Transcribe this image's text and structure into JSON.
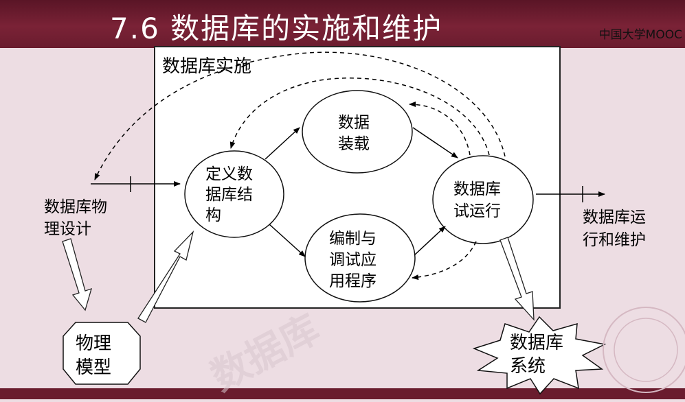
{
  "slide": {
    "title": "7.6 数据库的实施和维护",
    "logo_text": "中国大学MOOC",
    "watermark": "数据库"
  },
  "diagram": {
    "box_title": "数据库实施",
    "nodes": {
      "define": [
        "定义数",
        "据库结",
        "构"
      ],
      "load": [
        "数据",
        "装载"
      ],
      "program": [
        "编制与",
        "调试应",
        "用程序"
      ],
      "trial": [
        "数据库",
        "试运行"
      ],
      "physical_design": [
        "数据库物",
        "理设计"
      ],
      "operation": [
        "数据库运",
        "行和维护"
      ],
      "physical_model": [
        "物理",
        "模型"
      ],
      "db_system": [
        "数据库",
        "系统"
      ]
    }
  },
  "colors": {
    "title_bar": "#6a1c2e",
    "background": "#eddde3",
    "box": "#ffffff"
  }
}
